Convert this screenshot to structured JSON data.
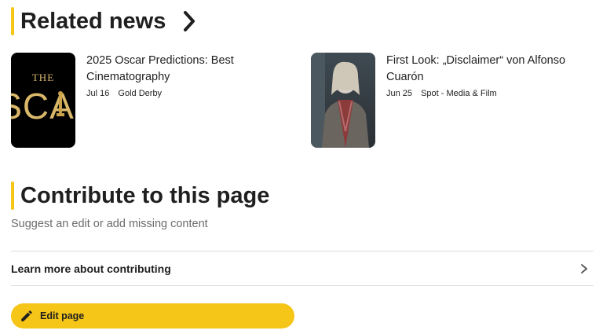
{
  "related": {
    "title": "Related news",
    "items": [
      {
        "title": "2025 Oscar Predictions: Best Cinematography",
        "date": "Jul 16",
        "source": "Gold Derby",
        "thumb_text": "THE",
        "thumb_text2": "SCA"
      },
      {
        "title": "First Look: „Disclaimer“ von Alfonso Cuarón",
        "date": "Jun 25",
        "source": "Spot - Media & Film"
      }
    ]
  },
  "contribute": {
    "title": "Contribute to this page",
    "subtitle": "Suggest an edit or add missing content",
    "learn_more": "Learn more about contributing",
    "edit_label": "Edit page"
  },
  "colors": {
    "accent": "#f5c518",
    "text": "#1f1f1f",
    "muted": "#6b6b6b",
    "divider": "#dcdcdc"
  },
  "icons": {
    "section_chevron": "chevron-right-icon",
    "row_chevron": "chevron-right-icon",
    "edit": "pencil-icon"
  }
}
